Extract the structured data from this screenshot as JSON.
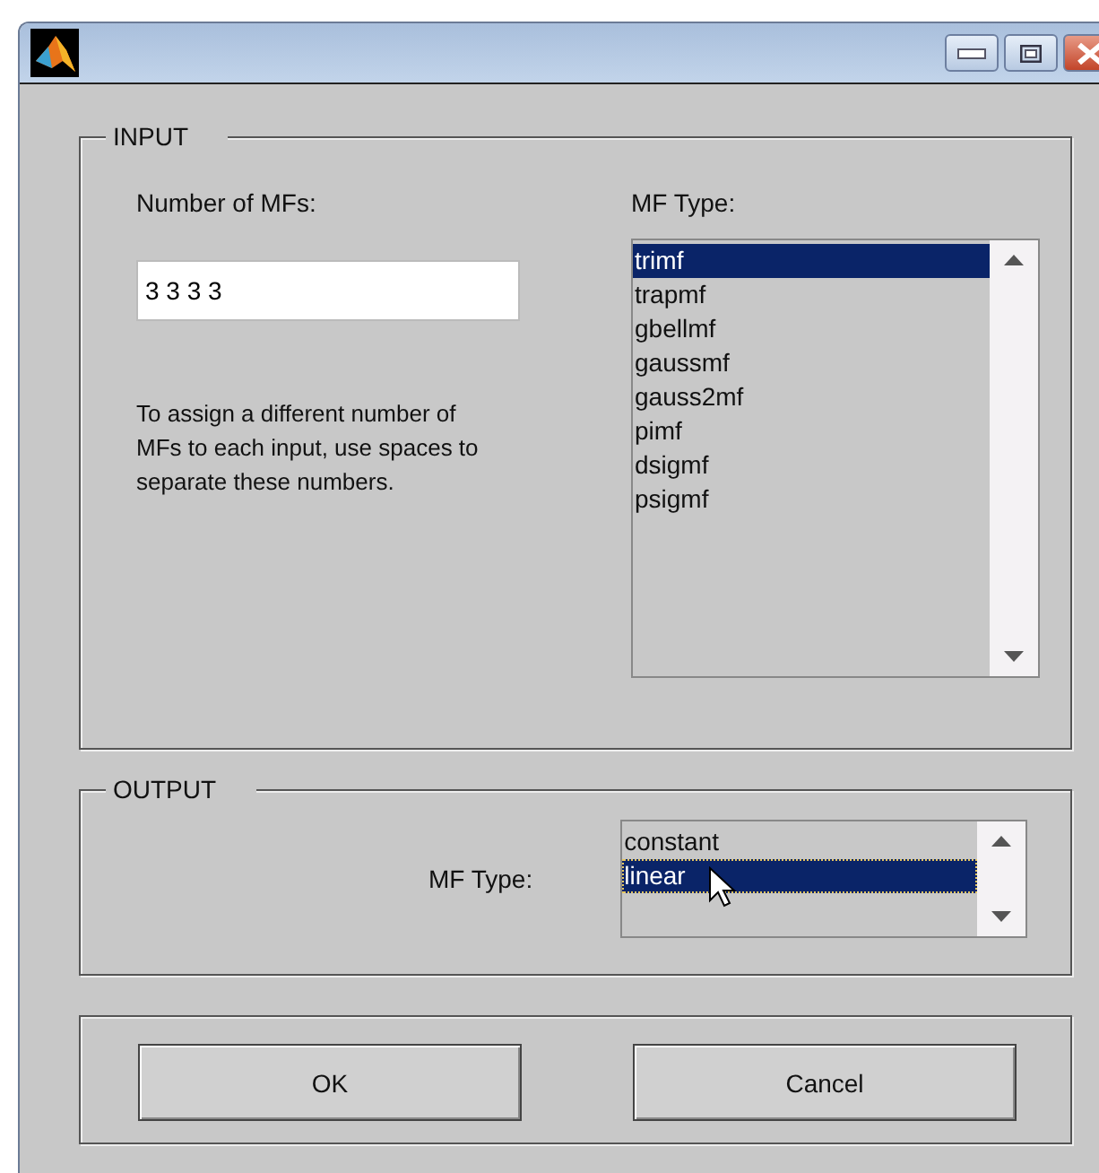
{
  "input": {
    "legend": "INPUT",
    "count_label": "Number of MFs:",
    "count_value": "3 3 3 3",
    "help": "To assign a different number of MFs to each input, use spaces to separate these numbers.",
    "type_label": "MF Type:",
    "types": [
      {
        "label": "trimf",
        "selected": true
      },
      {
        "label": "trapmf",
        "selected": false
      },
      {
        "label": "gbellmf",
        "selected": false
      },
      {
        "label": "gaussmf",
        "selected": false
      },
      {
        "label": "gauss2mf",
        "selected": false
      },
      {
        "label": "pimf",
        "selected": false
      },
      {
        "label": "dsigmf",
        "selected": false
      },
      {
        "label": "psigmf",
        "selected": false
      }
    ]
  },
  "output": {
    "legend": "OUTPUT",
    "type_label": "MF Type:",
    "types": [
      {
        "label": "constant",
        "selected": false
      },
      {
        "label": "linear",
        "selected": true
      }
    ]
  },
  "buttons": [
    "OK",
    "Cancel"
  ]
}
